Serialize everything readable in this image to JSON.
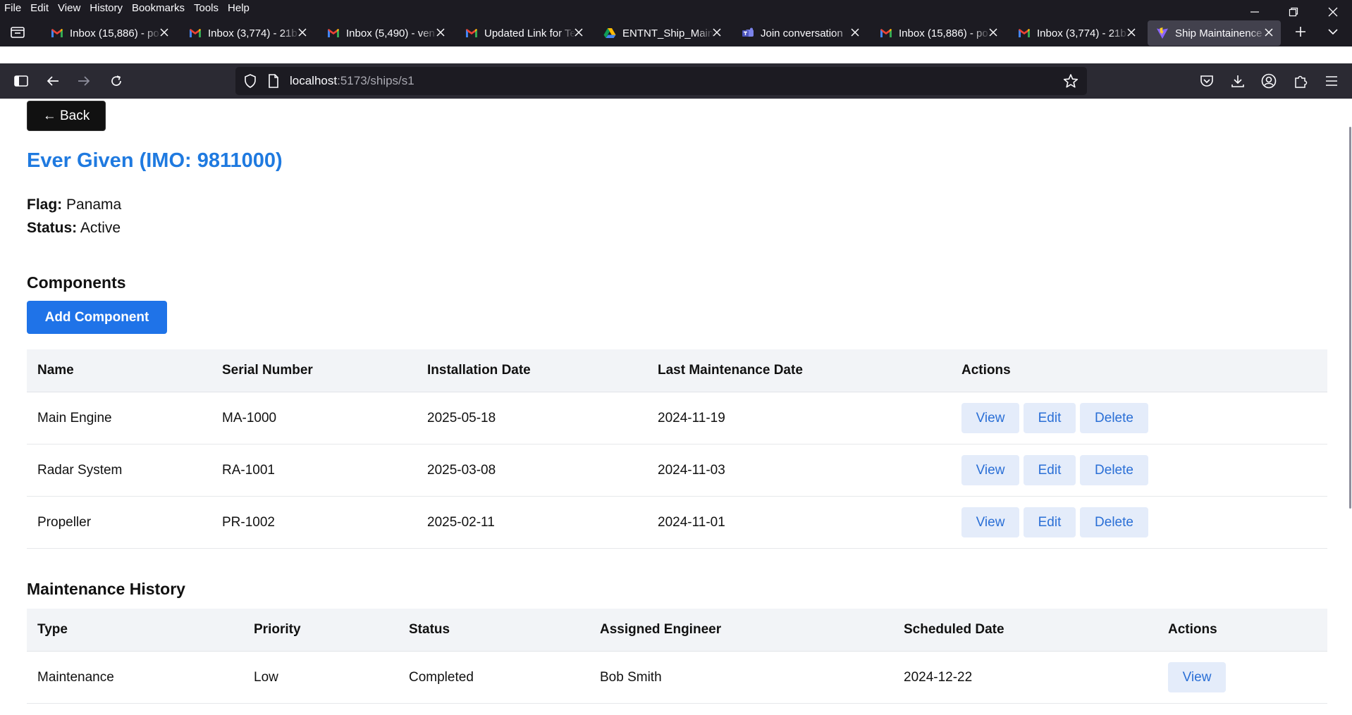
{
  "browser": {
    "menu": [
      "File",
      "Edit",
      "View",
      "History",
      "Bookmarks",
      "Tools",
      "Help"
    ],
    "tabs": [
      {
        "title": "Inbox (15,886) - po",
        "icon": "gmail-icon"
      },
      {
        "title": "Inbox (3,774) - 21b",
        "icon": "gmail-icon"
      },
      {
        "title": "Inbox (5,490) - ven",
        "icon": "gmail-icon"
      },
      {
        "title": "Updated Link for Te",
        "icon": "gmail-icon"
      },
      {
        "title": "ENTNT_Ship_Maint",
        "icon": "google-drive-icon"
      },
      {
        "title": "Join conversation",
        "icon": "teams-icon"
      },
      {
        "title": "Inbox (15,886) - po",
        "icon": "gmail-icon"
      },
      {
        "title": "Inbox (3,774) - 21b",
        "icon": "gmail-icon"
      },
      {
        "title": "Ship Maintainence",
        "icon": "vite-icon",
        "active": true
      }
    ],
    "url_host": "localhost",
    "url_path": ":5173/ships/s1"
  },
  "page": {
    "back_label": "← Back",
    "ship_title": "Ever Given (IMO: 9811000)",
    "flag_label": "Flag:",
    "flag_value": "Panama",
    "status_label": "Status:",
    "status_value": "Active",
    "components_heading": "Components",
    "add_component_label": "Add Component",
    "components_table": {
      "headers": [
        "Name",
        "Serial Number",
        "Installation Date",
        "Last Maintenance Date",
        "Actions"
      ],
      "rows": [
        [
          "Main Engine",
          "MA-1000",
          "2025-05-18",
          "2024-11-19"
        ],
        [
          "Radar System",
          "RA-1001",
          "2025-03-08",
          "2024-11-03"
        ],
        [
          "Propeller",
          "PR-1002",
          "2025-02-11",
          "2024-11-01"
        ]
      ],
      "actions": [
        "View",
        "Edit",
        "Delete"
      ]
    },
    "maintenance_heading": "Maintenance History",
    "maintenance_table": {
      "headers": [
        "Type",
        "Priority",
        "Status",
        "Assigned Engineer",
        "Scheduled Date",
        "Actions"
      ],
      "rows": [
        [
          "Maintenance",
          "Low",
          "Completed",
          "Bob Smith",
          "2024-12-22"
        ]
      ],
      "action": "View"
    }
  },
  "colors": {
    "title_blue": "#1f7ae0",
    "primary_button": "#1f73e8",
    "action_button_bg": "#e4ecfa",
    "action_button_text": "#2a6fd6"
  }
}
